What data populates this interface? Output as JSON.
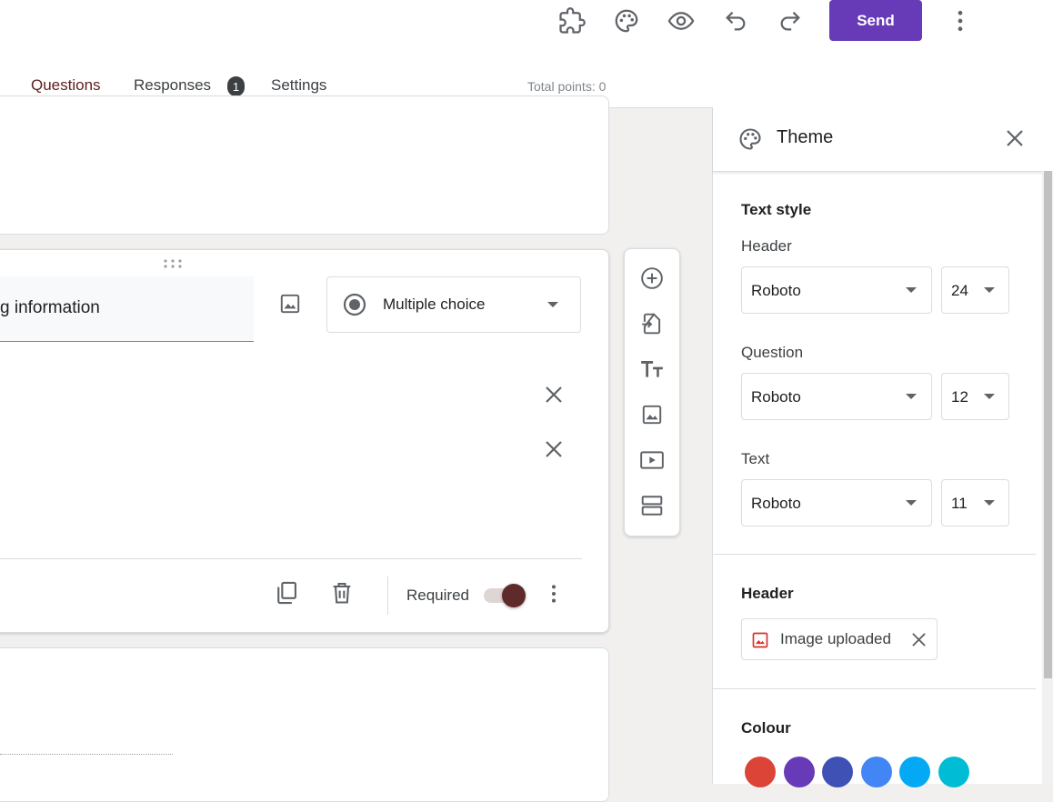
{
  "toolbar": {
    "send_label": "Send",
    "icons": [
      "puzzle-icon",
      "palette-icon",
      "eye-icon",
      "undo-icon",
      "redo-icon",
      "more-vert-icon"
    ]
  },
  "tabs": [
    {
      "label": "Questions",
      "active": true
    },
    {
      "label": "Responses",
      "badge": "1"
    },
    {
      "label": "Settings"
    }
  ],
  "total_points": "Total points: 0",
  "question": {
    "title_visible": "g information",
    "type": "Multiple choice",
    "required_label": "Required",
    "required": true
  },
  "float_toolbar_icons": [
    "add-question-icon",
    "import-questions-icon",
    "add-title-icon",
    "add-image-icon",
    "add-video-icon",
    "add-section-icon"
  ],
  "theme": {
    "title": "Theme",
    "text_style": {
      "title": "Text style",
      "header": {
        "label": "Header",
        "font": "Roboto",
        "size": "24"
      },
      "question": {
        "label": "Question",
        "font": "Roboto",
        "size": "12"
      },
      "text": {
        "label": "Text",
        "font": "Roboto",
        "size": "11"
      }
    },
    "header_section": {
      "title": "Header",
      "chip": "Image uploaded"
    },
    "colour": {
      "title": "Colour",
      "swatches": [
        "#db4437",
        "#673ab7",
        "#3f51b5",
        "#4285f4",
        "#03a9f4",
        "#00bcd4"
      ]
    }
  },
  "colors": {
    "accent": "#673ab7",
    "active_tab": "#5f1e1e",
    "toggle": "#5f2a2a"
  }
}
